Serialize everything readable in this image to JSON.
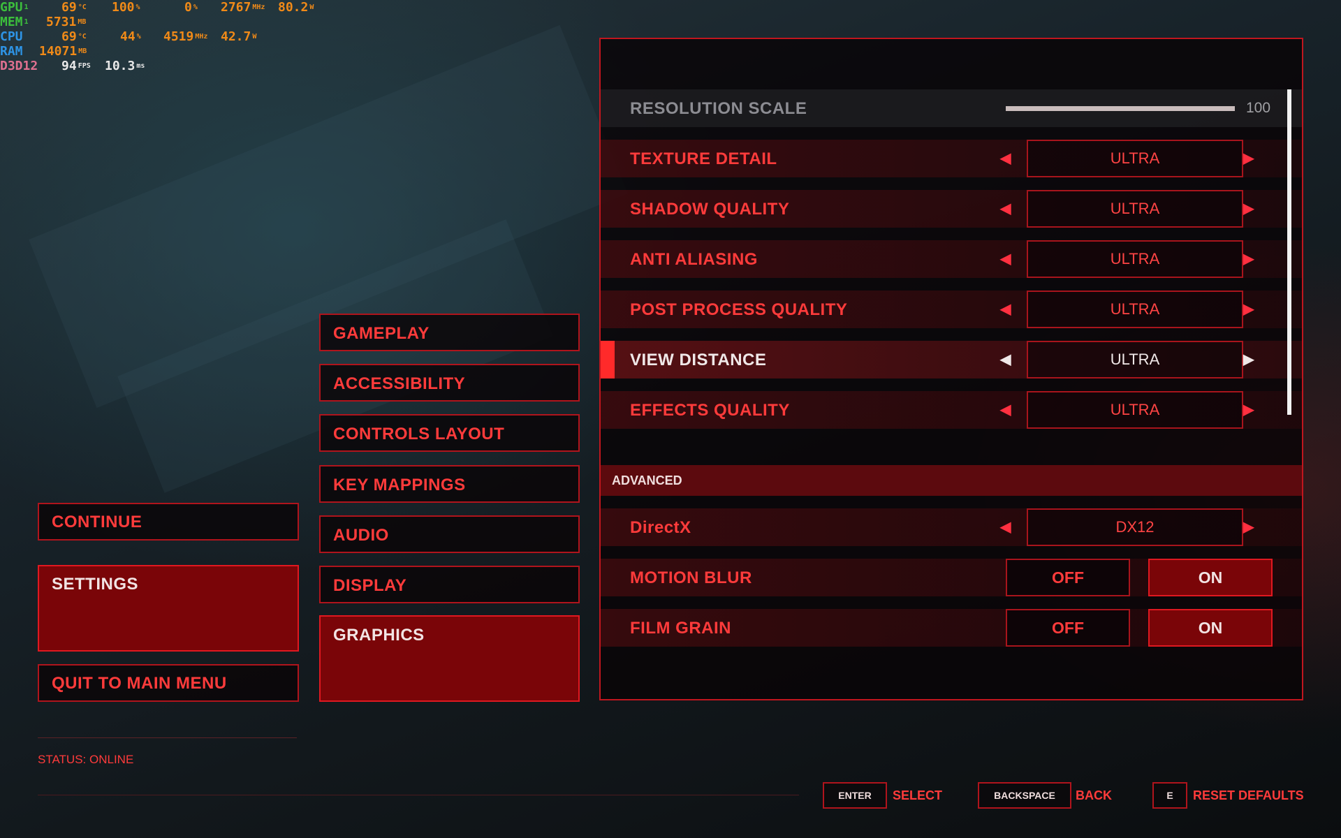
{
  "hud": {
    "gpu": {
      "label": "GPU",
      "sub": "1",
      "temp": "69",
      "temp_unit": "°C",
      "load": "100",
      "load_unit": "%",
      "mem_load": "0",
      "mem_load_unit": "%",
      "clock": "2767",
      "clock_unit": "MHz",
      "power": "80.2",
      "power_unit": "W"
    },
    "mem": {
      "label": "MEM",
      "sub": "1",
      "value": "5731",
      "unit": "MB"
    },
    "cpu": {
      "label": "CPU",
      "temp": "69",
      "temp_unit": "°C",
      "load": "44",
      "load_unit": "%",
      "clock": "4519",
      "clock_unit": "MHz",
      "power": "42.7",
      "power_unit": "W"
    },
    "ram": {
      "label": "RAM",
      "value": "14071",
      "unit": "MB"
    },
    "d3d": {
      "label": "D3D12",
      "fps": "94",
      "fps_unit": "FPS",
      "frametime": "10.3",
      "frametime_unit": "ms"
    }
  },
  "main_menu": {
    "continue": "CONTINUE",
    "settings": "SETTINGS",
    "quit": "QUIT TO MAIN MENU",
    "status": "STATUS: ONLINE"
  },
  "settings_menu": {
    "gameplay": "GAMEPLAY",
    "accessibility": "ACCESSIBILITY",
    "controls_layout": "CONTROLS LAYOUT",
    "key_mappings": "KEY MAPPINGS",
    "audio": "AUDIO",
    "display": "DISPLAY",
    "graphics": "GRAPHICS"
  },
  "graphics": {
    "resolution_scale": {
      "label": "RESOLUTION SCALE",
      "value": "100"
    },
    "texture_detail": {
      "label": "TEXTURE DETAIL",
      "value": "ULTRA"
    },
    "shadow_quality": {
      "label": "SHADOW QUALITY",
      "value": "ULTRA"
    },
    "anti_aliasing": {
      "label": "ANTI ALIASING",
      "value": "ULTRA"
    },
    "post_process_quality": {
      "label": "POST PROCESS QUALITY",
      "value": "ULTRA"
    },
    "view_distance": {
      "label": "VIEW DISTANCE",
      "value": "ULTRA"
    },
    "effects_quality": {
      "label": "EFFECTS QUALITY",
      "value": "ULTRA"
    },
    "advanced_header": "ADVANCED",
    "directx": {
      "label": "DirectX",
      "value": "DX12"
    },
    "motion_blur": {
      "label": "MOTION BLUR",
      "off": "OFF",
      "on": "ON"
    },
    "film_grain": {
      "label": "FILM GRAIN",
      "off": "OFF",
      "on": "ON"
    }
  },
  "footer": {
    "enter_key": "ENTER",
    "enter_action": "SELECT",
    "backspace_key": "BACKSPACE",
    "backspace_action": "BACK",
    "e_key": "E",
    "e_action": "RESET DEFAULTS"
  },
  "icons": {
    "left_arrow": "left-triangle",
    "right_arrow": "right-triangle"
  },
  "colors": {
    "accent": "#ff3b3b",
    "active_fill": "#7a0508",
    "border": "#b0141c"
  }
}
